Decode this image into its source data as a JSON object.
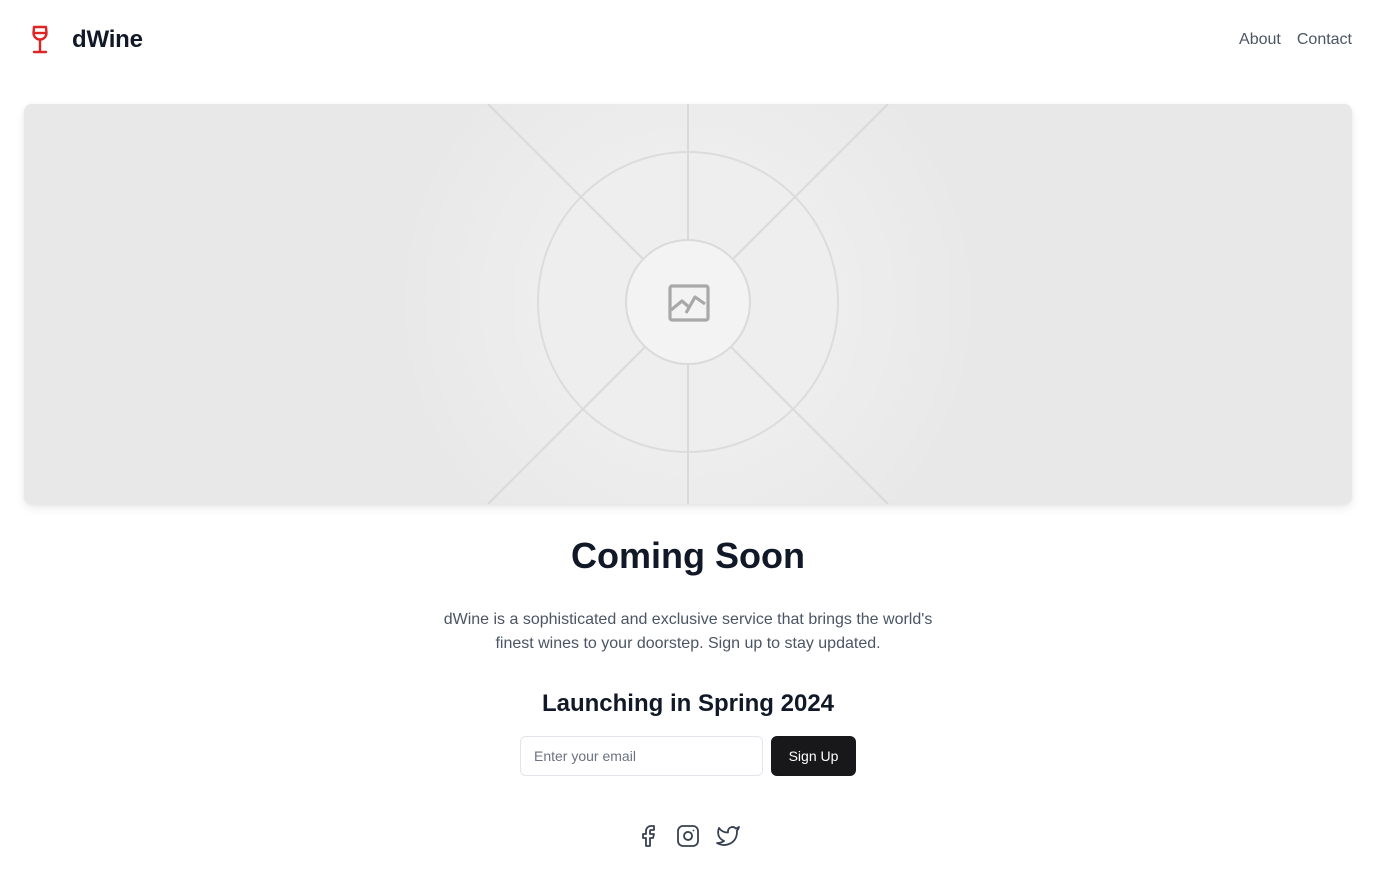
{
  "header": {
    "brand_name": "dWine",
    "nav": [
      {
        "label": "About"
      },
      {
        "label": "Contact"
      }
    ]
  },
  "hero": {
    "icon": "image-placeholder-icon"
  },
  "main": {
    "title": "Coming Soon",
    "description": "dWine is a sophisticated and exclusive service that brings the world's finest wines to your doorstep. Sign up to stay updated.",
    "subtitle": "Launching in Spring 2024",
    "email_placeholder": "Enter your email",
    "signup_label": "Sign Up"
  },
  "social": [
    "facebook-icon",
    "instagram-icon",
    "twitter-icon"
  ],
  "colors": {
    "brand_accent": "#dc2626",
    "button_bg": "#18181b",
    "text_primary": "#111827",
    "text_secondary": "#4b5563",
    "hero_bg": "#e8e8e8"
  }
}
